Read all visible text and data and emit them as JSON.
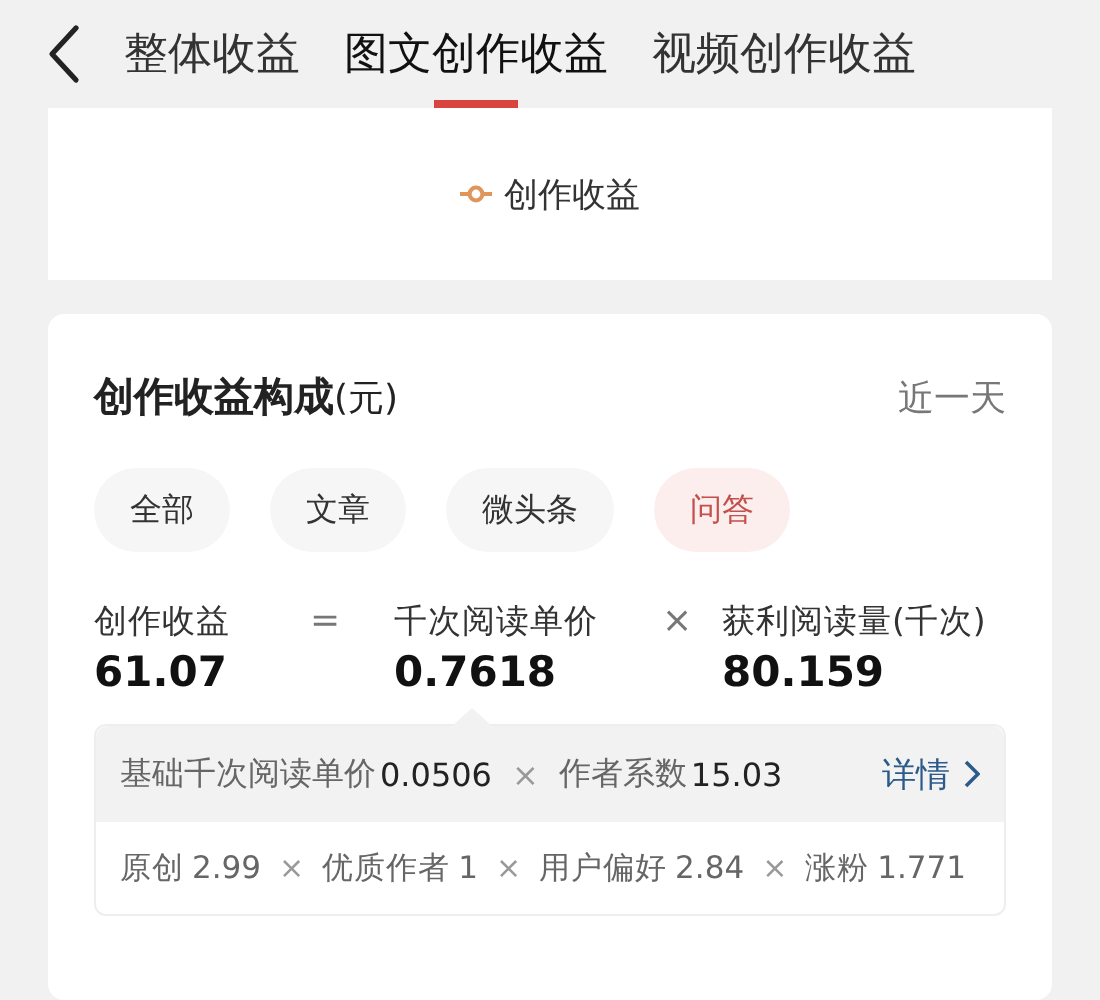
{
  "tabs": [
    {
      "label": "整体收益",
      "selected": false
    },
    {
      "label": "图文创作收益",
      "selected": true
    },
    {
      "label": "视频创作收益",
      "selected": false
    }
  ],
  "legend": {
    "label": "创作收益"
  },
  "breakdown": {
    "title": "**创作收益构成**(元)",
    "period": "近一天",
    "filters": [
      {
        "label": "全部",
        "selected": false
      },
      {
        "label": "文章",
        "selected": false
      },
      {
        "label": "微头条",
        "selected": false
      },
      {
        "label": "问答",
        "selected": true
      }
    ],
    "formula": {
      "terms": [
        {
          "label": "创作收益",
          "value": "61.07"
        },
        {
          "label": "千次阅读单价",
          "value": "0.7618"
        },
        {
          "label": "获利阅读量(千次)",
          "value": "80.159"
        }
      ],
      "operators": [
        "=",
        "×"
      ]
    },
    "base": {
      "items": [
        {
          "label": "基础千次阅读单价",
          "value": "0.0506"
        },
        {
          "label": "作者系数",
          "value": "15.03"
        }
      ],
      "operators": [
        "×"
      ],
      "link": "详情"
    },
    "factors": {
      "items": [
        {
          "label": "原创",
          "value": "2.99"
        },
        {
          "label": "优质作者",
          "value": "1"
        },
        {
          "label": "用户偏好",
          "value": "2.84"
        },
        {
          "label": "涨粉",
          "value": "1.771"
        }
      ],
      "operators": [
        "×",
        "×",
        "×"
      ]
    }
  }
}
